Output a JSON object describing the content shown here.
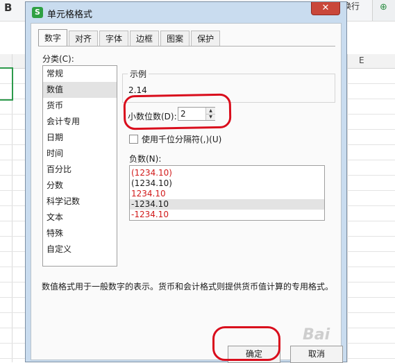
{
  "sheet": {
    "bold_label": "B",
    "wrap_label": "换行",
    "column_e": "E",
    "fx_icon": "formula-icon"
  },
  "dialog": {
    "title": "单元格格式",
    "app_icon_letter": "S",
    "close_glyph": "✕",
    "tabs": [
      {
        "label": "数字",
        "active": true
      },
      {
        "label": "对齐",
        "active": false
      },
      {
        "label": "字体",
        "active": false
      },
      {
        "label": "边框",
        "active": false
      },
      {
        "label": "图案",
        "active": false
      },
      {
        "label": "保护",
        "active": false
      }
    ],
    "category_label": "分类(C):",
    "categories": [
      {
        "label": "常规",
        "selected": false
      },
      {
        "label": "数值",
        "selected": true
      },
      {
        "label": "货币",
        "selected": false
      },
      {
        "label": "会计专用",
        "selected": false
      },
      {
        "label": "日期",
        "selected": false
      },
      {
        "label": "时间",
        "selected": false
      },
      {
        "label": "百分比",
        "selected": false
      },
      {
        "label": "分数",
        "selected": false
      },
      {
        "label": "科学记数",
        "selected": false
      },
      {
        "label": "文本",
        "selected": false
      },
      {
        "label": "特殊",
        "selected": false
      },
      {
        "label": "自定义",
        "selected": false
      }
    ],
    "sample_title": "示例",
    "sample_value": "2.14",
    "decimal_label": "小数位数(D):",
    "decimal_value": "2",
    "thousands_label": "使用千位分隔符(,)(U)",
    "thousands_checked": false,
    "negative_label": "负数(N):",
    "negatives": [
      {
        "label": "(1234.10)",
        "color": "#d11a1a",
        "selected": false
      },
      {
        "label": "(1234.10)",
        "color": "#1a1a1a",
        "selected": false
      },
      {
        "label": "1234.10",
        "color": "#d11a1a",
        "selected": false
      },
      {
        "label": "-1234.10",
        "color": "#1a1a1a",
        "selected": true
      },
      {
        "label": "-1234.10",
        "color": "#d11a1a",
        "selected": false
      }
    ],
    "description": "数值格式用于一般数字的表示。货币和会计格式则提供货币值计算的专用格式。",
    "ok_label": "确定",
    "cancel_label": "取消"
  },
  "colors": {
    "dialog_frame": "#c9dcef",
    "annotation_red": "#d90d1c",
    "active_cell_green": "#2c9a4b",
    "negative_red": "#d11a1a"
  },
  "watermark": "Bai"
}
